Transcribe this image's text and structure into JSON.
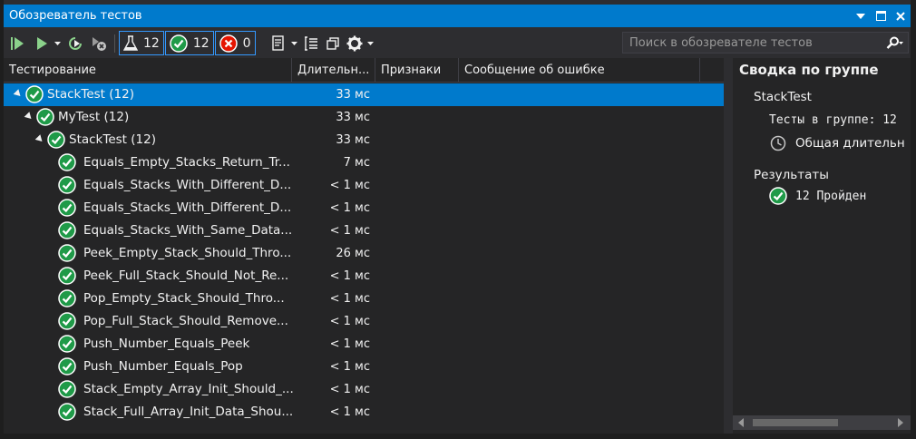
{
  "window": {
    "title": "Обозреватель тестов",
    "accent": "#007acc"
  },
  "toolbar": {
    "run_all_icon": "run-all-icon",
    "run_icon": "run-icon",
    "total_count": "12",
    "passed_count": "12",
    "failed_count": "0",
    "search_placeholder": "Поиск в обозревателе тестов"
  },
  "columns": {
    "test": "Тестирование",
    "duration": "Длительн...",
    "traits": "Признаки",
    "error": "Сообщение об ошибке"
  },
  "rows": [
    {
      "name": "StackTest  (12)",
      "duration": "33 мс",
      "level": 0,
      "expanded": true,
      "selected": true
    },
    {
      "name": "MyTest  (12)",
      "duration": "33 мс",
      "level": 1,
      "expanded": true
    },
    {
      "name": "StackTest  (12)",
      "duration": "33 мс",
      "level": 2,
      "expanded": true
    },
    {
      "name": "Equals_Empty_Stacks_Return_Tr...",
      "duration": "7 мс",
      "level": 3
    },
    {
      "name": "Equals_Stacks_With_Different_D...",
      "duration": "< 1 мс",
      "level": 3
    },
    {
      "name": "Equals_Stacks_With_Different_D...",
      "duration": "< 1 мс",
      "level": 3
    },
    {
      "name": "Equals_Stacks_With_Same_Data...",
      "duration": "< 1 мс",
      "level": 3
    },
    {
      "name": "Peek_Empty_Stack_Should_Thro...",
      "duration": "26 мс",
      "level": 3
    },
    {
      "name": "Peek_Full_Stack_Should_Not_Re...",
      "duration": "< 1 мс",
      "level": 3
    },
    {
      "name": "Pop_Empty_Stack_Should_Thro...",
      "duration": "< 1 мс",
      "level": 3
    },
    {
      "name": "Pop_Full_Stack_Should_Remove...",
      "duration": "< 1 мс",
      "level": 3
    },
    {
      "name": "Push_Number_Equals_Peek",
      "duration": "< 1 мс",
      "level": 3
    },
    {
      "name": "Push_Number_Equals_Pop",
      "duration": "< 1 мс",
      "level": 3
    },
    {
      "name": "Stack_Empty_Array_Init_Should_...",
      "duration": "< 1 мс",
      "level": 3
    },
    {
      "name": "Stack_Full_Array_Init_Data_Shou...",
      "duration": "< 1 мс",
      "level": 3
    }
  ],
  "summary": {
    "heading": "Сводка по группе",
    "group": "StackTest",
    "tests_in_group": "Тесты в группе:  12",
    "total_duration": "Общая длительн",
    "results_label": "Результаты",
    "passed": "12  Пройден"
  }
}
